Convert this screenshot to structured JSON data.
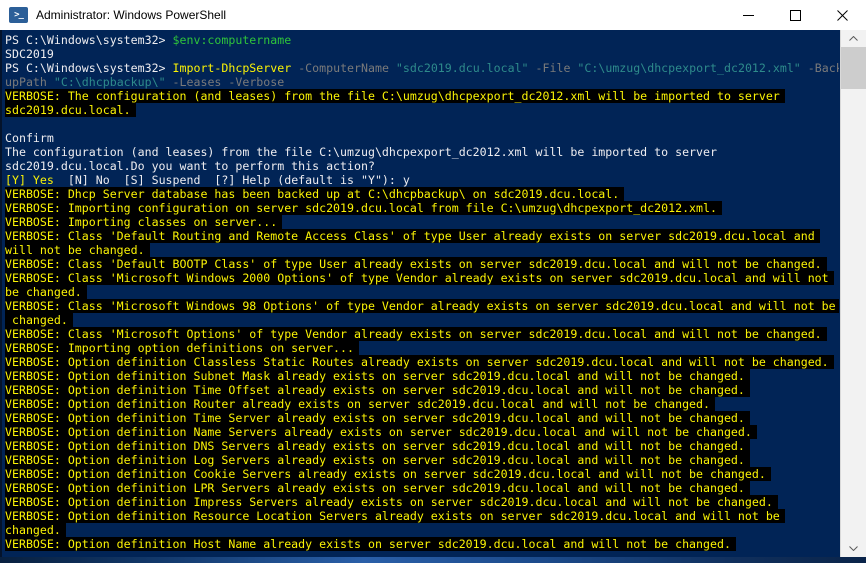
{
  "window": {
    "title": "Administrator: Windows PowerShell",
    "app_icon": "powershell-icon",
    "controls": [
      "minimize",
      "maximize",
      "close"
    ]
  },
  "colors": {
    "background": "#012456",
    "foreground": "#EEEDF0",
    "verbose_yellow": "#FBF305",
    "variable_green": "#2FC43B",
    "parameter_gray": "#7A7A7A",
    "string_cyan": "#2E8B8B",
    "highlight_black": "#000000",
    "titlebar": "#FFFFFF"
  },
  "scrollbar": {
    "up_icon": "chevron-up-icon",
    "down_icon": "chevron-down-icon",
    "thumb": "scrollbar-thumb"
  },
  "terminal": {
    "lines": [
      [
        {
          "t": "PS C:\\Windows\\system32> ",
          "c": "fg"
        },
        {
          "t": "$env:computername",
          "c": "green"
        }
      ],
      [
        {
          "t": "SDC2019",
          "c": "fg"
        }
      ],
      [
        {
          "t": "PS C:\\Windows\\system32> ",
          "c": "fg"
        },
        {
          "t": "Import-DhcpServer",
          "c": "yellow"
        },
        {
          "t": " ",
          "c": "fg"
        },
        {
          "t": "-ComputerName",
          "c": "gray"
        },
        {
          "t": " ",
          "c": "fg"
        },
        {
          "t": "\"sdc2019.dcu.local\"",
          "c": "cyan"
        },
        {
          "t": " ",
          "c": "fg"
        },
        {
          "t": "-File",
          "c": "gray"
        },
        {
          "t": " ",
          "c": "fg"
        },
        {
          "t": "\"C:\\umzug\\dhcpexport_dc2012.xml\"",
          "c": "cyan"
        },
        {
          "t": " ",
          "c": "fg"
        },
        {
          "t": "-Back",
          "c": "gray"
        }
      ],
      [
        {
          "t": "upPath ",
          "c": "gray"
        },
        {
          "t": "\"C:\\dhcpbackup\\\"",
          "c": "cyan"
        },
        {
          "t": " ",
          "c": "fg"
        },
        {
          "t": "-Leases -Verbose",
          "c": "gray"
        }
      ],
      [
        {
          "t": "VERBOSE: The configuration (and leases) from the file C:\\umzug\\dhcpexport_dc2012.xml will be imported to server",
          "c": "yellow",
          "hl": true
        }
      ],
      [
        {
          "t": "sdc2019.dcu.local.",
          "c": "yellow",
          "hl": true
        }
      ],
      [],
      [
        {
          "t": "Confirm",
          "c": "fg"
        }
      ],
      [
        {
          "t": "The configuration (and leases) from the file C:\\umzug\\dhcpexport_dc2012.xml will be imported to server",
          "c": "fg"
        }
      ],
      [
        {
          "t": "sdc2019.dcu.local.Do you want to perform this action?",
          "c": "fg"
        }
      ],
      [
        {
          "t": "[Y] Yes",
          "c": "yellow"
        },
        {
          "t": "  [N] No  [S] Suspend  [?] Help (default is \"Y\"): y",
          "c": "fg"
        }
      ],
      [
        {
          "t": "VERBOSE: Dhcp Server database has been backed up at C:\\dhcpbackup\\ on sdc2019.dcu.local.",
          "c": "yellow",
          "hl": true
        }
      ],
      [
        {
          "t": "VERBOSE: Importing configuration on server sdc2019.dcu.local from file C:\\umzug\\dhcpexport_dc2012.xml.",
          "c": "yellow",
          "hl": true
        }
      ],
      [
        {
          "t": "VERBOSE: Importing classes on server...",
          "c": "yellow",
          "hl": true
        }
      ],
      [
        {
          "t": "VERBOSE: Class 'Default Routing and Remote Access Class' of type User already exists on server sdc2019.dcu.local and",
          "c": "yellow",
          "hl": true
        }
      ],
      [
        {
          "t": "will not be changed.",
          "c": "yellow",
          "hl": true
        }
      ],
      [
        {
          "t": "VERBOSE: Class 'Default BOOTP Class' of type User already exists on server sdc2019.dcu.local and will not be changed.",
          "c": "yellow",
          "hl": true
        }
      ],
      [
        {
          "t": "VERBOSE: Class 'Microsoft Windows 2000 Options' of type Vendor already exists on server sdc2019.dcu.local and will not",
          "c": "yellow",
          "hl": true
        }
      ],
      [
        {
          "t": "be changed.",
          "c": "yellow",
          "hl": true
        }
      ],
      [
        {
          "t": "VERBOSE: Class 'Microsoft Windows 98 Options' of type Vendor already exists on server sdc2019.dcu.local and will not be",
          "c": "yellow",
          "hl": true
        }
      ],
      [
        {
          "t": " changed.",
          "c": "yellow",
          "hl": true
        }
      ],
      [
        {
          "t": "VERBOSE: Class 'Microsoft Options' of type Vendor already exists on server sdc2019.dcu.local and will not be changed.",
          "c": "yellow",
          "hl": true
        }
      ],
      [
        {
          "t": "VERBOSE: Importing option definitions on server...",
          "c": "yellow",
          "hl": true
        }
      ],
      [
        {
          "t": "VERBOSE: Option definition Classless Static Routes already exists on server sdc2019.dcu.local and will not be changed.",
          "c": "yellow",
          "hl": true
        }
      ],
      [
        {
          "t": "VERBOSE: Option definition Subnet Mask already exists on server sdc2019.dcu.local and will not be changed.",
          "c": "yellow",
          "hl": true
        }
      ],
      [
        {
          "t": "VERBOSE: Option definition Time Offset already exists on server sdc2019.dcu.local and will not be changed.",
          "c": "yellow",
          "hl": true
        }
      ],
      [
        {
          "t": "VERBOSE: Option definition Router already exists on server sdc2019.dcu.local and will not be changed.",
          "c": "yellow",
          "hl": true
        }
      ],
      [
        {
          "t": "VERBOSE: Option definition Time Server already exists on server sdc2019.dcu.local and will not be changed.",
          "c": "yellow",
          "hl": true
        }
      ],
      [
        {
          "t": "VERBOSE: Option definition Name Servers already exists on server sdc2019.dcu.local and will not be changed.",
          "c": "yellow",
          "hl": true
        }
      ],
      [
        {
          "t": "VERBOSE: Option definition DNS Servers already exists on server sdc2019.dcu.local and will not be changed.",
          "c": "yellow",
          "hl": true
        }
      ],
      [
        {
          "t": "VERBOSE: Option definition Log Servers already exists on server sdc2019.dcu.local and will not be changed.",
          "c": "yellow",
          "hl": true
        }
      ],
      [
        {
          "t": "VERBOSE: Option definition Cookie Servers already exists on server sdc2019.dcu.local and will not be changed.",
          "c": "yellow",
          "hl": true
        }
      ],
      [
        {
          "t": "VERBOSE: Option definition LPR Servers already exists on server sdc2019.dcu.local and will not be changed.",
          "c": "yellow",
          "hl": true
        }
      ],
      [
        {
          "t": "VERBOSE: Option definition Impress Servers already exists on server sdc2019.dcu.local and will not be changed.",
          "c": "yellow",
          "hl": true
        }
      ],
      [
        {
          "t": "VERBOSE: Option definition Resource Location Servers already exists on server sdc2019.dcu.local and will not be",
          "c": "yellow",
          "hl": true
        }
      ],
      [
        {
          "t": "changed.",
          "c": "yellow",
          "hl": true
        }
      ],
      [
        {
          "t": "VERBOSE: Option definition Host Name already exists on server sdc2019.dcu.local and will not be changed.",
          "c": "yellow",
          "hl": true
        }
      ]
    ]
  }
}
